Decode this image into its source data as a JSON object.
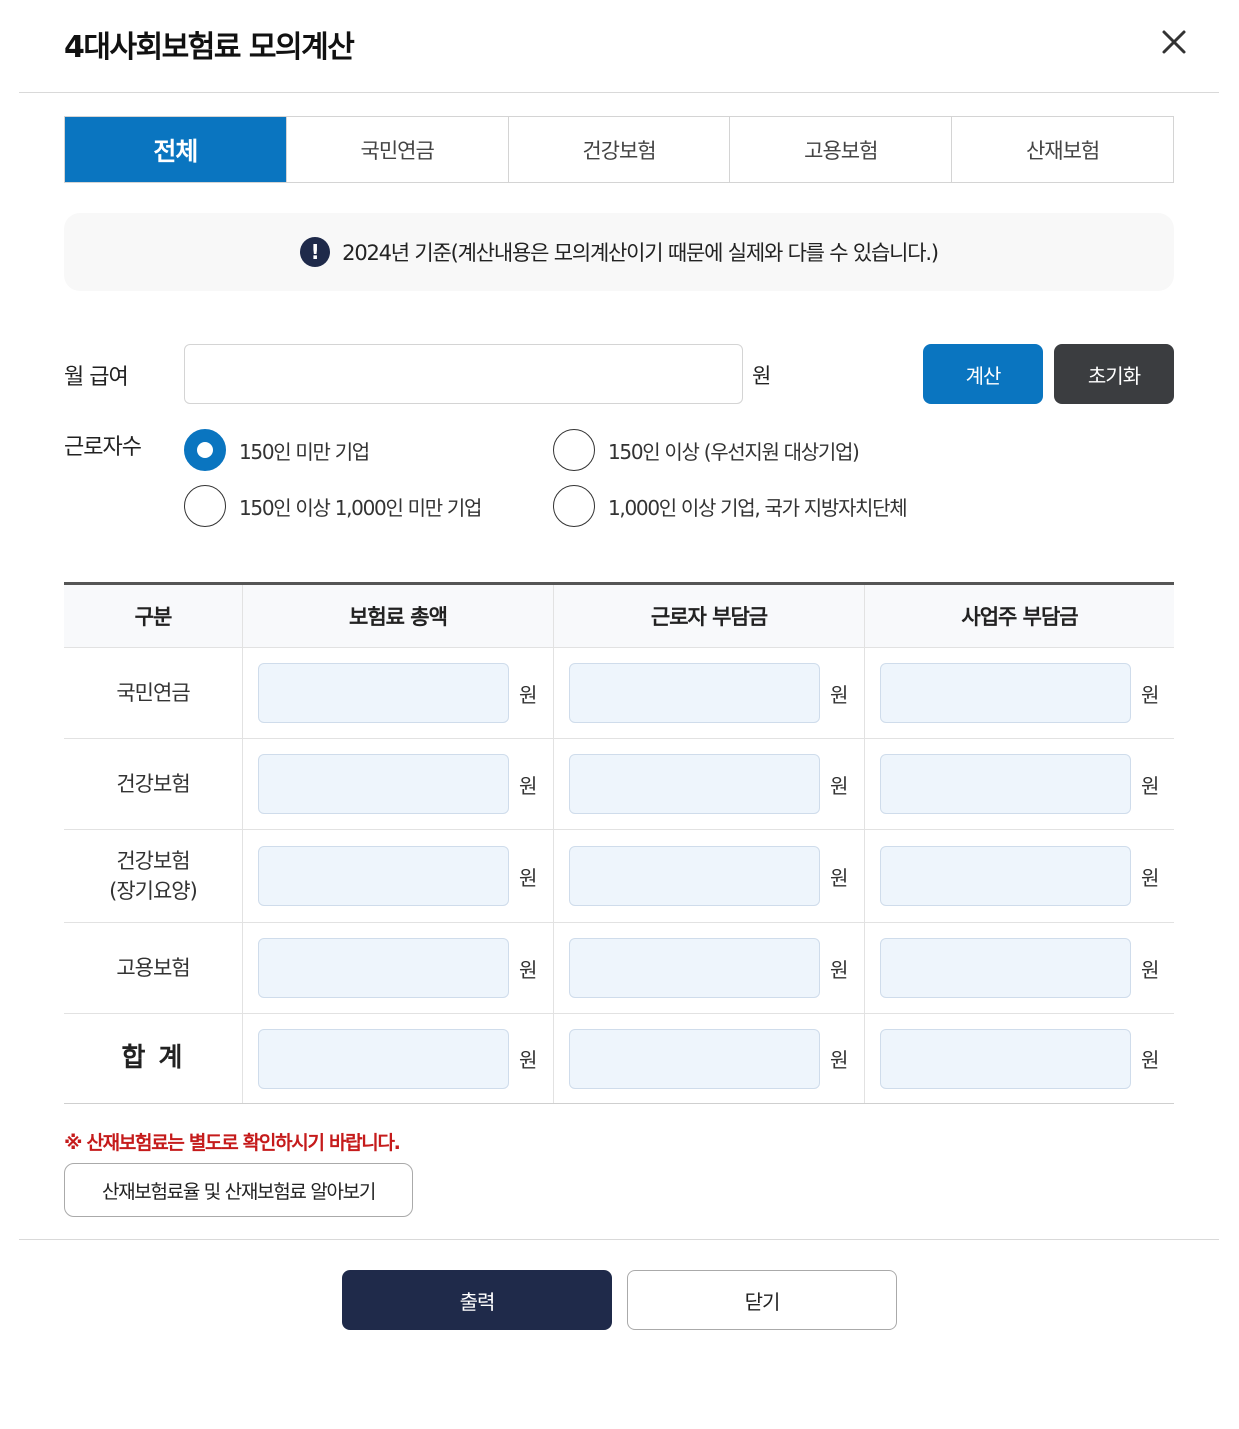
{
  "header": {
    "title": "4대사회보험료 모의계산",
    "close_icon": "close-icon"
  },
  "tabs": [
    {
      "label": "전체",
      "active": true
    },
    {
      "label": "국민연금",
      "active": false
    },
    {
      "label": "건강보험",
      "active": false
    },
    {
      "label": "고용보험",
      "active": false
    },
    {
      "label": "산재보험",
      "active": false
    }
  ],
  "notice": {
    "icon": "exclamation-icon",
    "text": "2024년 기준(계산내용은 모의계산이기 때문에 실제와 다를 수 있습니다.)"
  },
  "form": {
    "salary_label": "월 급여",
    "salary_value": "",
    "salary_unit": "원",
    "calc_label": "계산",
    "reset_label": "초기화",
    "workers_label": "근로자수",
    "worker_options": [
      {
        "label": "150인 미만 기업",
        "checked": true
      },
      {
        "label": "150인 이상 (우선지원 대상기업)",
        "checked": false
      },
      {
        "label": "150인 이상 1,000인 미만 기업",
        "checked": false
      },
      {
        "label": "1,000인 이상 기업, 국가 지방자치단체",
        "checked": false
      }
    ]
  },
  "table": {
    "headers": [
      "구분",
      "보험료 총액",
      "근로자 부담금",
      "사업주 부담금"
    ],
    "unit": "원",
    "rows": [
      {
        "label": "국민연금",
        "values": [
          "",
          "",
          ""
        ]
      },
      {
        "label": "건강보험",
        "values": [
          "",
          "",
          ""
        ]
      },
      {
        "label": "건강보험\n(장기요양)",
        "values": [
          "",
          "",
          ""
        ]
      },
      {
        "label": "고용보험",
        "values": [
          "",
          "",
          ""
        ]
      },
      {
        "label": "합 계",
        "values": [
          "",
          "",
          ""
        ]
      }
    ]
  },
  "footer": {
    "warning": "※ 산재보험료는 별도로 확인하시기 바랍니다.",
    "link_label": "산재보험료율 및 산재보험료 알아보기",
    "print_label": "출력",
    "close_label": "닫기"
  },
  "colors": {
    "accent": "#0a75c0",
    "dark_button": "#3b3d40",
    "navy_button": "#1f2a4a",
    "warning": "#c51b1b",
    "result_field": "#eef5fc"
  }
}
